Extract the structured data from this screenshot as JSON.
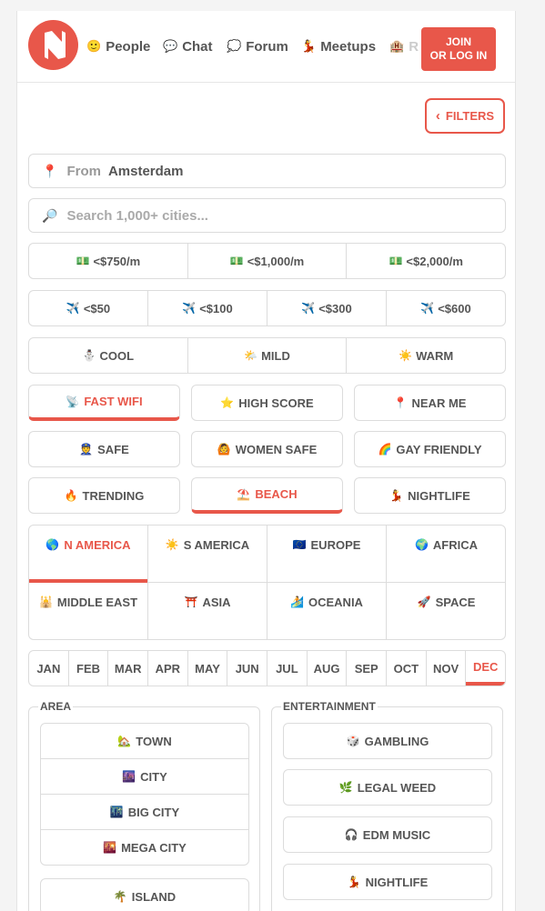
{
  "header": {
    "nav": [
      {
        "icon": "🙂",
        "label": "People"
      },
      {
        "icon": "💬",
        "label": "Chat"
      },
      {
        "icon": "💭",
        "label": "Forum"
      },
      {
        "icon": "💃",
        "label": "Meetups"
      }
    ],
    "nav_cut_icon": "🏨",
    "nav_cut_label": "R",
    "join_line1": "JOIN",
    "join_line2": "OR LOG IN"
  },
  "filters": {
    "label": "FILTERS"
  },
  "from": {
    "icon": "📍",
    "prefix": "From",
    "value": "Amsterdam"
  },
  "search": {
    "icon": "🔎",
    "placeholder": "Search 1,000+ cities..."
  },
  "cost": [
    {
      "icon": "💵",
      "label": "<$750/m"
    },
    {
      "icon": "💵",
      "label": "<$1,000/m"
    },
    {
      "icon": "💵",
      "label": "<$2,000/m"
    }
  ],
  "flights": [
    {
      "icon": "✈️",
      "label": "<$50"
    },
    {
      "icon": "✈️",
      "label": "<$100"
    },
    {
      "icon": "✈️",
      "label": "<$300"
    },
    {
      "icon": "✈️",
      "label": "<$600"
    }
  ],
  "climate": [
    {
      "icon": "⛄",
      "label": "COOL"
    },
    {
      "icon": "🌤️",
      "label": "MILD"
    },
    {
      "icon": "☀️",
      "label": "WARM"
    }
  ],
  "tags": [
    {
      "icon": "📡",
      "label": "FAST WIFI",
      "active": true
    },
    {
      "icon": "⭐",
      "label": "HIGH SCORE",
      "active": false
    },
    {
      "icon": "📍",
      "label": "NEAR ME",
      "active": false
    },
    {
      "icon": "👮",
      "label": "SAFE",
      "active": false
    },
    {
      "icon": "🙆",
      "label": "WOMEN SAFE",
      "active": false
    },
    {
      "icon": "🌈",
      "label": "GAY FRIENDLY",
      "active": false
    },
    {
      "icon": "🔥",
      "label": "TRENDING",
      "active": false
    },
    {
      "icon": "⛱️",
      "label": "BEACH",
      "active": true
    },
    {
      "icon": "💃",
      "label": "NIGHTLIFE",
      "active": false
    }
  ],
  "regions": [
    {
      "icon": "🌎",
      "label": "N AMERICA",
      "active": true
    },
    {
      "icon": "☀️",
      "label": "S AMERICA",
      "active": false
    },
    {
      "icon": "🇪🇺",
      "label": "EUROPE",
      "active": false
    },
    {
      "icon": "🌍",
      "label": "AFRICA",
      "active": false
    },
    {
      "icon": "🕌",
      "label": "MIDDLE EAST",
      "active": false
    },
    {
      "icon": "⛩️",
      "label": "ASIA",
      "active": false
    },
    {
      "icon": "🏄",
      "label": "OCEANIA",
      "active": false
    },
    {
      "icon": "🚀",
      "label": "SPACE",
      "active": false
    }
  ],
  "months": [
    "JAN",
    "FEB",
    "MAR",
    "APR",
    "MAY",
    "JUN",
    "JUL",
    "AUG",
    "SEP",
    "OCT",
    "NOV",
    "DEC"
  ],
  "active_month": "DEC",
  "area": {
    "title": "AREA",
    "items": [
      {
        "icon": "🏡",
        "label": "TOWN"
      },
      {
        "icon": "🌆",
        "label": "CITY"
      },
      {
        "icon": "🌃",
        "label": "BIG CITY"
      },
      {
        "icon": "🌇",
        "label": "MEGA CITY"
      },
      {
        "icon": "🌴",
        "label": "ISLAND"
      }
    ]
  },
  "entertainment": {
    "title": "ENTERTAINMENT",
    "items": [
      {
        "icon": "🎲",
        "label": "GAMBLING"
      },
      {
        "icon": "🌿",
        "label": "LEGAL WEED"
      },
      {
        "icon": "🎧",
        "label": "EDM MUSIC"
      },
      {
        "icon": "💃",
        "label": "NIGHTLIFE"
      }
    ]
  },
  "colors": {
    "accent": "#e8574a",
    "border": "#dcdcdc",
    "text": "#555555"
  }
}
